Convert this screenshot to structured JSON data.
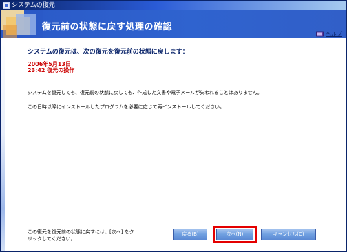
{
  "window": {
    "title": "システムの復元"
  },
  "header": {
    "title": "復元前の状態に戻す処理の確認",
    "help_label": "ヘルプ"
  },
  "content": {
    "intro": "システムの復元は、次の復元を復元前の状態に戻します：",
    "restore_point": {
      "date": "2006年5月13日",
      "description": "23:42 復元の操作"
    },
    "paragraph1": "システムを復元しても、復元前の状態に戻しても、作成した文書や電子メールが失われることはありません。",
    "paragraph2": "この日時以降にインストールしたプログラムを必要に応じて再インストールしてください。"
  },
  "footer": {
    "line1": "この復元を復元前の状態に戻すには、[次へ] をク",
    "line2": "リックしてください。"
  },
  "buttons": {
    "back": "戻る(B)",
    "next": "次へ(N)",
    "cancel": "キャンセル(C)"
  },
  "colors": {
    "header": "#2f63cf",
    "highlight": "#e40000",
    "restore_text": "#cc0000",
    "intro_text": "#0a246a"
  }
}
